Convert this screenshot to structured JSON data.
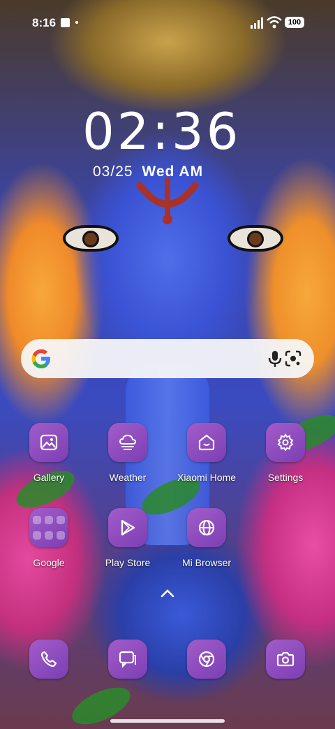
{
  "status_bar": {
    "time": "8:16",
    "battery": "100"
  },
  "lock_clock": {
    "time": "02:36",
    "date": "03/25",
    "weekday": "Wed AM"
  },
  "search": {
    "mic_icon": "mic-icon",
    "lens_icon": "google-lens-icon"
  },
  "apps": [
    {
      "label": "Gallery",
      "icon": "gallery-icon"
    },
    {
      "label": "Weather",
      "icon": "weather-icon"
    },
    {
      "label": "Xiaomi Home",
      "icon": "xiaomi-home-icon"
    },
    {
      "label": "Settings",
      "icon": "settings-icon"
    },
    {
      "label": "Google",
      "icon": "folder-icon"
    },
    {
      "label": "Play Store",
      "icon": "play-store-icon"
    },
    {
      "label": "Mi Browser",
      "icon": "browser-icon"
    }
  ],
  "dock": [
    {
      "icon": "phone-icon"
    },
    {
      "icon": "messages-icon"
    },
    {
      "icon": "chrome-icon"
    },
    {
      "icon": "camera-icon"
    }
  ],
  "colors": {
    "icon_tile": "#8c49be",
    "search_bar": "#f6f6f8"
  }
}
